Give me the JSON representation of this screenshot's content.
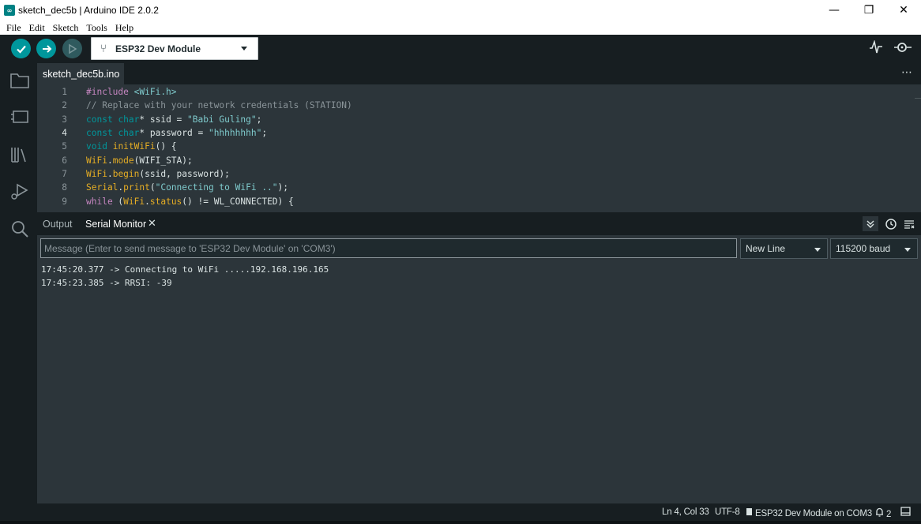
{
  "window": {
    "icon_text": "∞",
    "title": "sketch_dec5b | Arduino IDE 2.0.2",
    "minimize": "—",
    "maximize": "❐",
    "close": "✕"
  },
  "menu": [
    "File",
    "Edit",
    "Sketch",
    "Tools",
    "Help"
  ],
  "toolbar": {
    "verify_icon": "check-icon",
    "upload_icon": "arrow-right-icon",
    "debug_icon": "debug-icon",
    "board": "ESP32 Dev Module",
    "accent": "#00979c"
  },
  "tabs": {
    "active": "sketch_dec5b.ino",
    "more": "⋯"
  },
  "editor": {
    "active_line": 4,
    "lines": [
      "#include <WiFi.h>",
      "// Replace with your network credentials (STATION)",
      "const char* ssid = \"Babi Guling\";",
      "const char* password = \"hhhhhhhh\";",
      "void initWiFi() {",
      "WiFi.mode(WIFI_STA);",
      "WiFi.begin(ssid, password);",
      "Serial.print(\"Connecting to WiFi ..\");",
      "while (WiFi.status() != WL_CONNECTED) {"
    ],
    "line_numbers": [
      "1",
      "2",
      "3",
      "4",
      "5",
      "6",
      "7",
      "8",
      "9"
    ]
  },
  "panel": {
    "output_tab": "Output",
    "serial_tab": "Serial Monitor",
    "close": "✕",
    "message_placeholder": "Message (Enter to send message to 'ESP32 Dev Module' on 'COM3')",
    "line_ending": "New Line",
    "baud": "115200 baud",
    "lines": [
      "17:45:20.377 -> Connecting to WiFi .....192.168.196.165",
      "17:45:23.385 -> RRSI: -39"
    ]
  },
  "status": {
    "position": "Ln 4, Col 33",
    "encoding": "UTF-8",
    "board_port": "ESP32 Dev Module on COM3",
    "notifications": "2"
  }
}
